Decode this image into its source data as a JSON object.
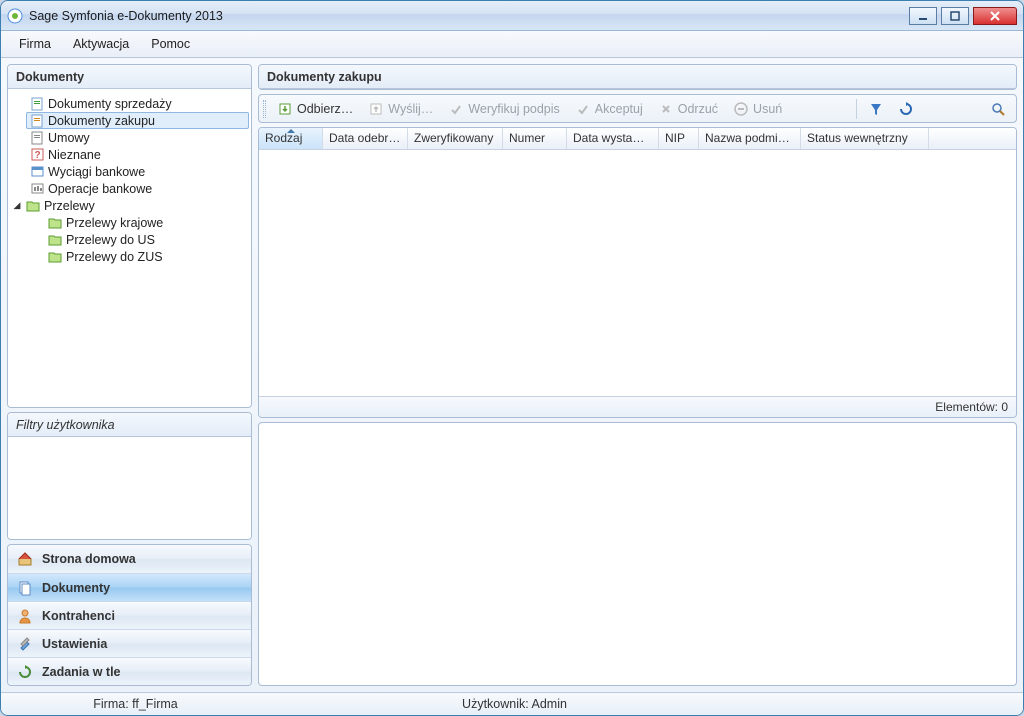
{
  "window": {
    "title": "Sage Symfonia e-Dokumenty 2013"
  },
  "menu": {
    "firma": "Firma",
    "aktywacja": "Aktywacja",
    "pomoc": "Pomoc"
  },
  "sidebar": {
    "title": "Dokumenty",
    "tree": {
      "dokumenty_sprzedazy": "Dokumenty sprzedaży",
      "dokumenty_zakupu": "Dokumenty zakupu",
      "umowy": "Umowy",
      "nieznane": "Nieznane",
      "wyciagi_bankowe": "Wyciągi bankowe",
      "operacje_bankowe": "Operacje bankowe",
      "przelewy": "Przelewy",
      "przelewy_krajowe": "Przelewy krajowe",
      "przelewy_do_us": "Przelewy do US",
      "przelewy_do_zus": "Przelewy do ZUS"
    },
    "filters_title": "Filtry użytkownika",
    "nav": {
      "home": "Strona domowa",
      "documents": "Dokumenty",
      "contractors": "Kontrahenci",
      "settings": "Ustawienia",
      "background_tasks": "Zadania w tle"
    }
  },
  "main": {
    "title": "Dokumenty zakupu",
    "toolbar": {
      "odbierz": "Odbierz…",
      "wyslij": "Wyślij…",
      "weryfikuj": "Weryfikuj podpis",
      "akceptuj": "Akceptuj",
      "odrzuc": "Odrzuć",
      "usun": "Usuń"
    },
    "columns": {
      "rodzaj": "Rodzaj",
      "data_odebrania": "Data odebra…",
      "zweryfikowany": "Zweryfikowany",
      "numer": "Numer",
      "data_wystawienia": "Data wystawi…",
      "nip": "NIP",
      "nazwa_podmiotu": "Nazwa podmiotu",
      "status_wewnetrzny": "Status wewnętrzny"
    },
    "footer": "Elementów: 0"
  },
  "status": {
    "firma": "Firma: ff_Firma",
    "user": "Użytkownik: Admin"
  }
}
